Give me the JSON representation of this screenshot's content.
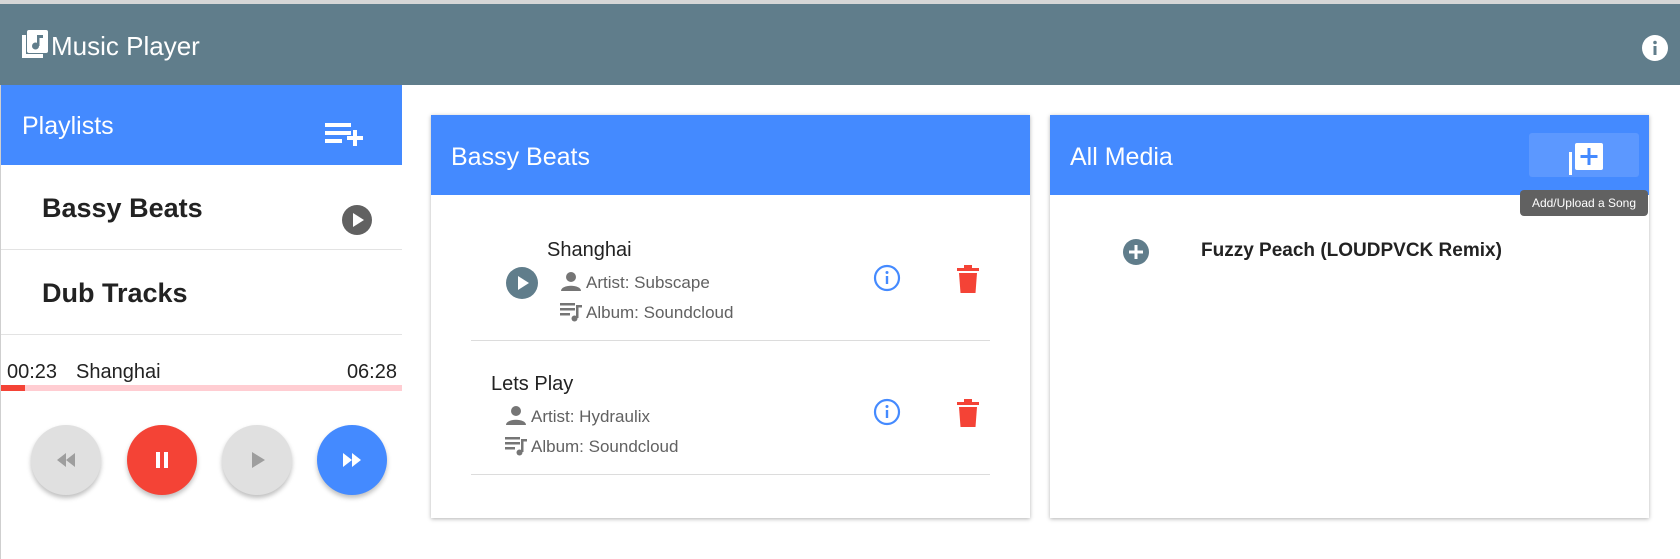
{
  "app": {
    "title": "Music Player"
  },
  "playlists": {
    "header": "Playlists",
    "items": [
      {
        "name": "Bassy Beats"
      },
      {
        "name": "Dub Tracks"
      }
    ]
  },
  "player": {
    "current_time": "00:23",
    "song": "Shanghai",
    "total_time": "06:28",
    "progress": 0.06
  },
  "playlist_view": {
    "title": "Bassy Beats",
    "songs": [
      {
        "title": "Shanghai",
        "artist": "Artist: Subscape",
        "album": "Album: Soundcloud"
      },
      {
        "title": "Lets Play",
        "artist": "Artist: Hydraulix",
        "album": "Album: Soundcloud"
      }
    ]
  },
  "media": {
    "title": "All Media",
    "tooltip": "Add/Upload a Song",
    "items": [
      {
        "name": "Fuzzy Peach (LOUDPVCK Remix)"
      }
    ]
  },
  "colors": {
    "appbar": "#607d8b",
    "accent": "#448aff",
    "danger": "#f44336"
  }
}
